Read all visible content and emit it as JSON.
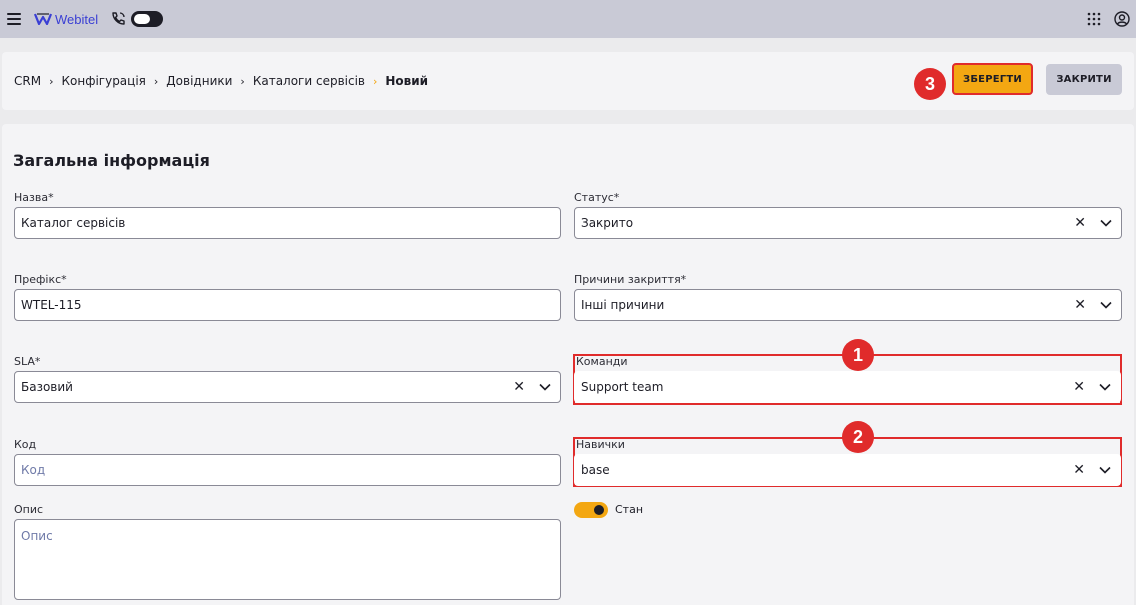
{
  "topbar": {
    "logo_text": "Webitel",
    "icons": [
      "menu-icon",
      "webitel-logo",
      "phone-icon",
      "status-switch",
      "apps-grid-icon",
      "account-icon"
    ]
  },
  "breadcrumb": {
    "items": [
      "CRM",
      "Конфігурація",
      "Довідники",
      "Каталоги сервісів"
    ],
    "current": "Новий"
  },
  "actions": {
    "save_label": "ЗБЕРЕГТИ",
    "close_label": "ЗАКРИТИ"
  },
  "form": {
    "title": "Загальна інформація",
    "name": {
      "label": "Назва*",
      "value": "Каталог сервісів"
    },
    "status": {
      "label": "Статус*",
      "value": "Закрито"
    },
    "prefix": {
      "label": "Префікс*",
      "value": "WTEL-115"
    },
    "close_reasons": {
      "label": "Причини закриття*",
      "value": "Інші причини"
    },
    "sla": {
      "label": "SLA*",
      "value": "Базовий"
    },
    "teams": {
      "label": "Команди",
      "value": "Support team"
    },
    "code": {
      "label": "Код",
      "placeholder": "Код"
    },
    "skills": {
      "label": "Навички",
      "value": "base"
    },
    "description": {
      "label": "Опис",
      "placeholder": "Опис"
    },
    "state": {
      "label": "Стан",
      "on": true
    }
  },
  "annotations": {
    "badge1": "1",
    "badge2": "2",
    "badge3": "3"
  },
  "glyphs": {
    "clear": "✕",
    "chevron": "⌄",
    "crumb_sep": "›"
  },
  "colors": {
    "accent": "#f3a712",
    "highlight": "#e02b2b",
    "topbar": "#c9cad6",
    "brand": "#3a3fd4"
  }
}
